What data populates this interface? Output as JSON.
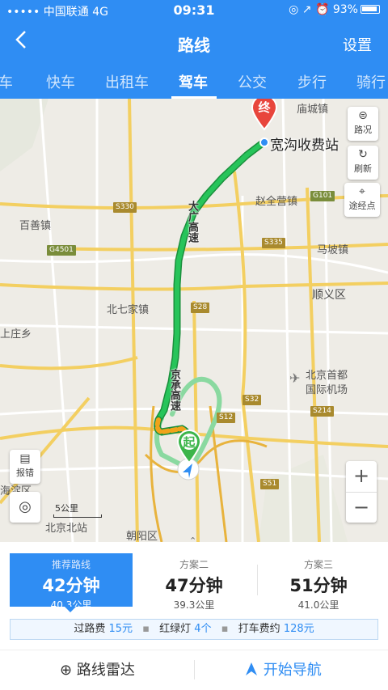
{
  "status_bar": {
    "carrier": "••••• 中国联通 4G",
    "time": "09:31",
    "right_icons": "◎ ↗ ⏰ 93%"
  },
  "nav": {
    "back_icon": "back-chevron-icon",
    "title": "路线",
    "settings_label": "设置"
  },
  "tabs": [
    "车",
    "快车",
    "出租车",
    "驾车",
    "公交",
    "步行",
    "骑行"
  ],
  "active_tab": "驾车",
  "map": {
    "destination_marker": "终",
    "origin_marker": "起",
    "destination_name": "宽沟收费站",
    "route_label_1": "大广高速",
    "route_label_2": "京承高速",
    "labels": {
      "miaocheng": "庙城镇",
      "baishan": "百善镇",
      "zhaoquanying": "赵全营镇",
      "mapo": "马坡镇",
      "shunyi": "顺义区",
      "beiqijia": "北七家镇",
      "capital_airport_1": "北京首都",
      "capital_airport_2": "国际机场",
      "chaoyang": "朝阳区",
      "haidian": "海淀区",
      "shangzhuang": "上庄乡",
      "beijing_north": "北京北站"
    },
    "road_signs": [
      "S330",
      "G101",
      "S335",
      "G4501",
      "S28",
      "S32",
      "S12",
      "S214",
      "S51"
    ],
    "controls": {
      "traffic": "路况",
      "refresh": "刷新",
      "waypoint": "途经点",
      "report": "报错"
    },
    "scale_label": "5公里",
    "zoom_in": "+",
    "zoom_out": "−",
    "chevron_up": "⌃"
  },
  "plans": [
    {
      "name": "推荐路线",
      "time": "42分钟",
      "distance": "40.3公里"
    },
    {
      "name": "方案二",
      "time": "47分钟",
      "distance": "39.3公里"
    },
    {
      "name": "方案三",
      "time": "51分钟",
      "distance": "41.0公里"
    }
  ],
  "info": {
    "toll_label": "过路费",
    "toll_value": "15元",
    "lights_label": "红绿灯",
    "lights_value": "4个",
    "taxi_label": "打车费约",
    "taxi_value": "128元"
  },
  "actions": {
    "radar": "路线雷达",
    "start_nav": "开始导航"
  },
  "colors": {
    "brand_blue": "#2f8df3",
    "route_green": "#1fb84c",
    "alt_route": "#8ad9a0",
    "destination_red": "#e8453c"
  }
}
